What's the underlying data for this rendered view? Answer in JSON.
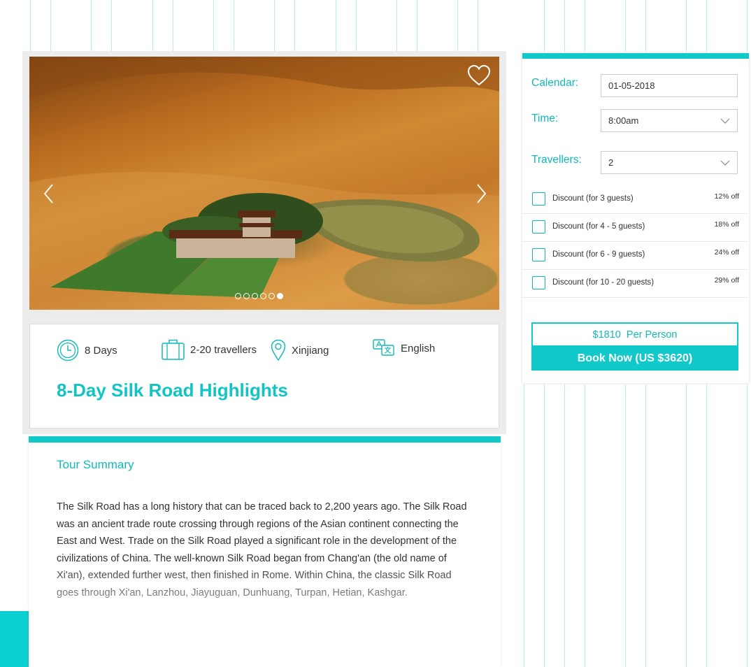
{
  "colors": {
    "accent": "#12c9c9",
    "text": "#333333"
  },
  "hero": {
    "favorite_icon": "heart-icon",
    "prev_icon": "chevron-left-icon",
    "next_icon": "chevron-right-icon",
    "carousel_dots": 6,
    "active_dot": 6
  },
  "features": [
    {
      "icon": "clock-icon",
      "label": "8 Days"
    },
    {
      "icon": "luggage-icon",
      "label": "2-20 travellers"
    },
    {
      "icon": "map-pin-icon",
      "label": "Xinjiang"
    },
    {
      "icon": "translate-icon",
      "label": "English"
    }
  ],
  "tour": {
    "title": "8-Day Silk Road Highlights"
  },
  "summary": {
    "heading": "Tour Summary",
    "text": "The Silk Road has a long history that can be traced back to 2,200 years ago. The Silk Road was an ancient trade route crossing through regions of the Asian continent connecting the East and West. Trade on the Silk Road played a significant role in the development of the civilizations of China. The well-known Silk Road began from Chang'an (the old name of Xi'an), extended further west, then finished in Rome. Within China, the classic Silk Road goes through Xi'an, Lanzhou, Jiayuguan, Dunhuang, Turpan, Hetian, Kashgar."
  },
  "booking": {
    "calendar_label": "Calendar:",
    "calendar_value": "01-05-2018",
    "time_label": "Time:",
    "time_value": "8:00am",
    "travellers_label": "Travellers:",
    "travellers_value": "2",
    "discounts": [
      {
        "label": "Discount (for 3 guests)",
        "off": "12% off"
      },
      {
        "label": "Discount (for 4 - 5 guests)",
        "off": "18% off"
      },
      {
        "label": "Discount (for 6 - 9 guests)",
        "off": "24% off"
      },
      {
        "label": "Discount (for 10 - 20 guests)",
        "off": "29% off"
      }
    ],
    "price": "$1810  Per Person",
    "book_now": "Book Now (US $3620)"
  }
}
